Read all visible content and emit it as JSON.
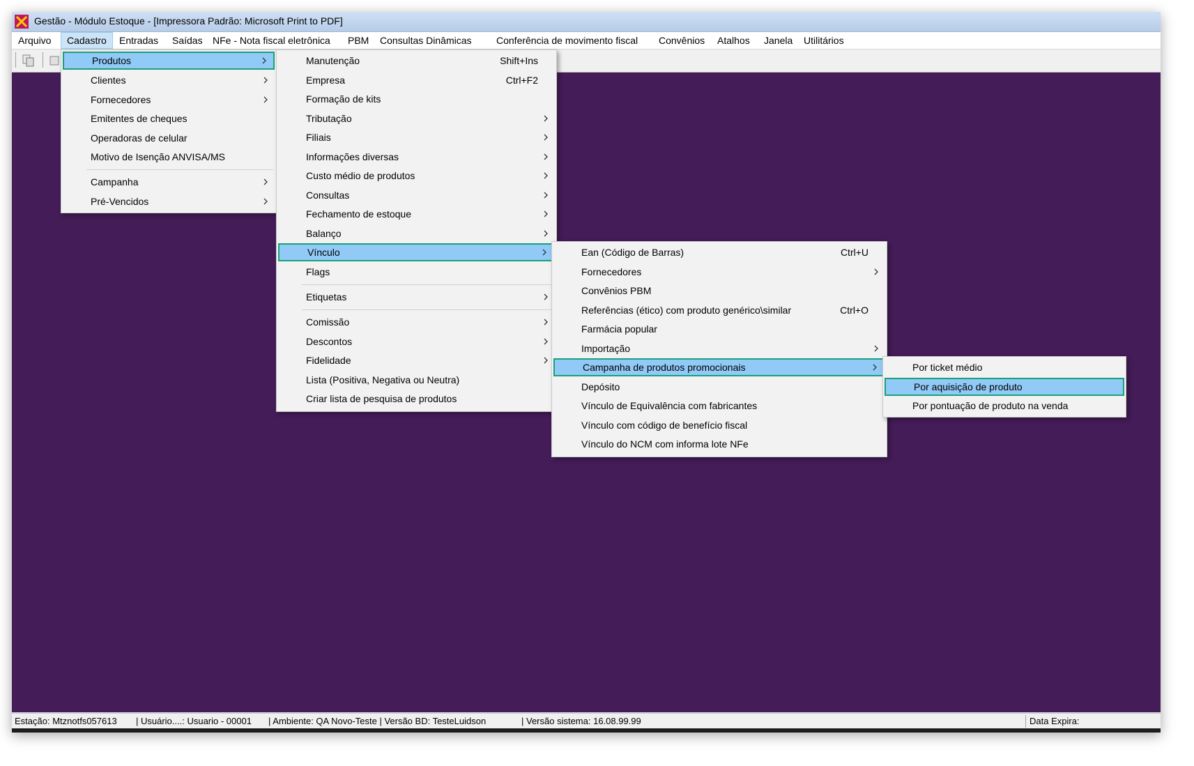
{
  "window": {
    "title": "Gestão  - Módulo Estoque - [Impressora Padrão: Microsoft Print to PDF]",
    "icon": "x-logo-icon",
    "accent": "#441c58",
    "highlight_border": "#19a07a",
    "highlight_fill": "#91c9f7"
  },
  "menubar": [
    {
      "label": "Arquivo"
    },
    {
      "label": "Cadastro"
    },
    {
      "label": "Entradas"
    },
    {
      "label": "Saídas"
    },
    {
      "label": "NFe - Nota fiscal eletrônica"
    },
    {
      "label": "PBM"
    },
    {
      "label": "Consultas Dinâmicas"
    },
    {
      "label": "Conferência de movimento fiscal"
    },
    {
      "label": "Convênios"
    },
    {
      "label": "Atalhos"
    },
    {
      "label": "Janela"
    },
    {
      "label": "Utilitários"
    }
  ],
  "menu_cadastro": [
    {
      "label": "Produtos",
      "arrow": true
    },
    {
      "label": "Clientes",
      "arrow": true
    },
    {
      "label": "Fornecedores",
      "arrow": true
    },
    {
      "label": "Emitentes de cheques"
    },
    {
      "label": "Operadoras de celular"
    },
    {
      "label": "Motivo de Isenção ANVISA/MS"
    },
    {
      "label": "Campanha",
      "arrow": true
    },
    {
      "label": "Pré-Vencidos",
      "arrow": true
    }
  ],
  "menu_produtos": [
    {
      "label": "Manutenção",
      "shortcut": "Shift+Ins"
    },
    {
      "label": "Empresa",
      "shortcut": "Ctrl+F2"
    },
    {
      "label": "Formação de kits"
    },
    {
      "label": "Tributação",
      "arrow": true
    },
    {
      "label": "Filiais",
      "arrow": true
    },
    {
      "label": "Informações diversas",
      "arrow": true
    },
    {
      "label": "Custo médio de produtos",
      "arrow": true
    },
    {
      "label": "Consultas",
      "arrow": true
    },
    {
      "label": "Fechamento de estoque",
      "arrow": true
    },
    {
      "label": "Balanço",
      "arrow": true
    },
    {
      "label": "Vínculo",
      "arrow": true
    },
    {
      "label": "Flags"
    },
    {
      "label": "Etiquetas",
      "arrow": true
    },
    {
      "label": "Comissão",
      "arrow": true
    },
    {
      "label": "Descontos",
      "arrow": true
    },
    {
      "label": "Fidelidade",
      "arrow": true
    },
    {
      "label": "Lista (Positiva, Negativa ou Neutra)"
    },
    {
      "label": "Criar lista de pesquisa de produtos"
    }
  ],
  "menu_vinculo": [
    {
      "label": "Ean (Código de Barras)",
      "shortcut": "Ctrl+U"
    },
    {
      "label": "Fornecedores",
      "arrow": true
    },
    {
      "label": "Convênios PBM"
    },
    {
      "label": "Referências (ético) com produto genérico\\similar",
      "shortcut": "Ctrl+O"
    },
    {
      "label": "Farmácia popular"
    },
    {
      "label": "Importação",
      "arrow": true
    },
    {
      "label": "Campanha de produtos promocionais",
      "arrow": true
    },
    {
      "label": "Depósito"
    },
    {
      "label": "Vínculo de Equivalência com fabricantes"
    },
    {
      "label": "Vínculo com código de benefício fiscal"
    },
    {
      "label": "Vínculo do NCM com informa lote NFe"
    }
  ],
  "menu_campanha": [
    {
      "label": "Por ticket médio"
    },
    {
      "label": "Por aquisição de produto"
    },
    {
      "label": "Por pontuação de produto na venda"
    }
  ],
  "status": {
    "estacao": "Estação: Mtznotfs057613",
    "usuario": "| Usuário....: Usuario - 00001",
    "ambiente": "| Ambiente: QA Novo-Teste | Versão BD: TesteLuidson",
    "versao": "| Versão sistema: 16.08.99.99",
    "data_expira": "Data Expira:"
  }
}
